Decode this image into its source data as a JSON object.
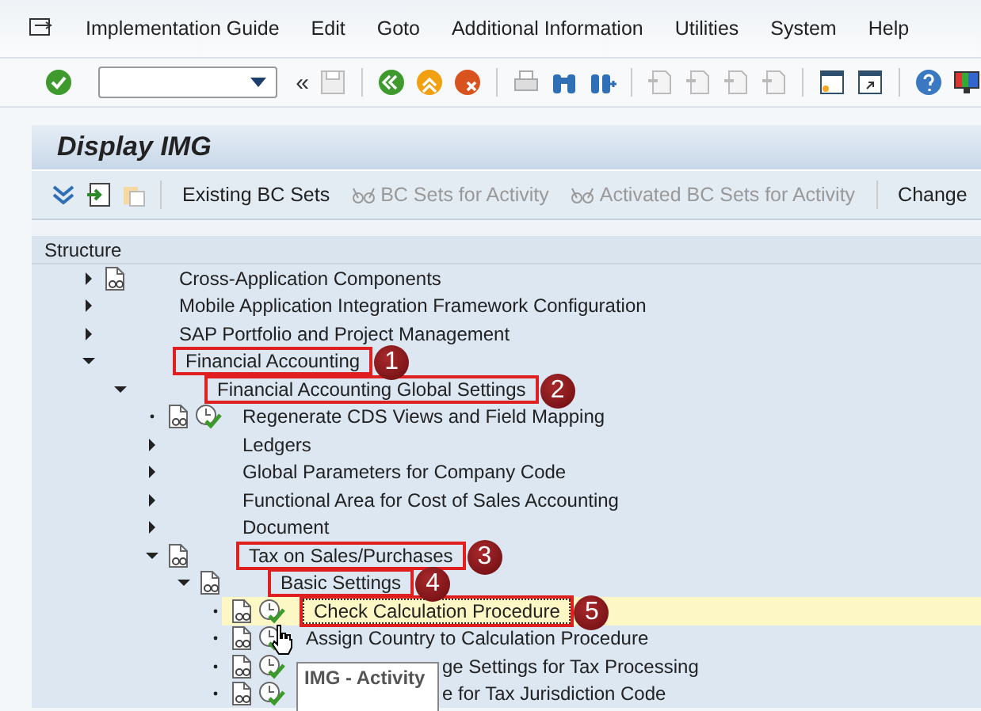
{
  "menu": [
    {
      "label": "Implementation Guide"
    },
    {
      "label": "Edit"
    },
    {
      "label": "Goto"
    },
    {
      "label": "Additional Information"
    },
    {
      "label": "Utilities"
    },
    {
      "label": "System"
    },
    {
      "label": "Help"
    }
  ],
  "toolbar": {
    "expand_label": "«"
  },
  "title": "Display IMG",
  "app_toolbar": [
    {
      "label": "Existing BC Sets",
      "disabled": false,
      "kind": "text"
    },
    {
      "label": "BC Sets for Activity",
      "disabled": true,
      "kind": "glasses"
    },
    {
      "label": "Activated BC Sets for Activity",
      "disabled": true,
      "kind": "glasses"
    },
    {
      "label": "Change",
      "disabled": false,
      "kind": "text"
    }
  ],
  "tree": {
    "header": "Structure",
    "items": [
      {
        "label": "Cross-Application Components",
        "kind": "folder",
        "expanded": false,
        "doc": true,
        "activity": false
      },
      {
        "label": "Mobile Application Integration Framework Configuration",
        "kind": "folder",
        "expanded": false,
        "doc": false,
        "activity": false
      },
      {
        "label": "SAP Portfolio and Project Management",
        "kind": "folder",
        "expanded": false,
        "doc": false,
        "activity": false
      },
      {
        "label": "Financial Accounting",
        "kind": "folder",
        "expanded": true,
        "doc": false,
        "activity": false,
        "marker": "1",
        "children": [
          {
            "label": "Financial Accounting Global Settings",
            "kind": "folder",
            "expanded": true,
            "doc": false,
            "activity": false,
            "marker": "2",
            "children": [
              {
                "label": "Regenerate CDS Views and Field Mapping",
                "kind": "leaf",
                "doc": true,
                "activity": true
              },
              {
                "label": "Ledgers",
                "kind": "folder",
                "expanded": false,
                "doc": false,
                "activity": false
              },
              {
                "label": "Global Parameters for Company Code",
                "kind": "folder",
                "expanded": false,
                "doc": false,
                "activity": false
              },
              {
                "label": "Functional Area for Cost of Sales Accounting",
                "kind": "folder",
                "expanded": false,
                "doc": false,
                "activity": false
              },
              {
                "label": "Document",
                "kind": "folder",
                "expanded": false,
                "doc": false,
                "activity": false
              },
              {
                "label": "Tax on Sales/Purchases",
                "kind": "folder",
                "expanded": true,
                "doc": true,
                "activity": false,
                "marker": "3",
                "children": [
                  {
                    "label": "Basic Settings",
                    "kind": "folder",
                    "expanded": true,
                    "doc": true,
                    "activity": false,
                    "marker": "4",
                    "children": [
                      {
                        "label": "Check Calculation Procedure",
                        "kind": "leaf",
                        "doc": true,
                        "activity": true,
                        "marker": "5",
                        "selected": true
                      },
                      {
                        "label": "Assign Country to Calculation Procedure",
                        "kind": "leaf",
                        "doc": true,
                        "activity": true,
                        "selected": false
                      },
                      {
                        "label": "ge Settings for Tax Processing",
                        "kind": "leaf",
                        "doc": true,
                        "activity": true,
                        "selected": false,
                        "partial": true
                      },
                      {
                        "label": "e for Tax Jurisdiction Code",
                        "kind": "leaf",
                        "doc": true,
                        "activity": true,
                        "selected": false,
                        "partial": true
                      }
                    ]
                  }
                ]
              }
            ]
          }
        ]
      }
    ]
  },
  "tooltip": "IMG - Activity"
}
